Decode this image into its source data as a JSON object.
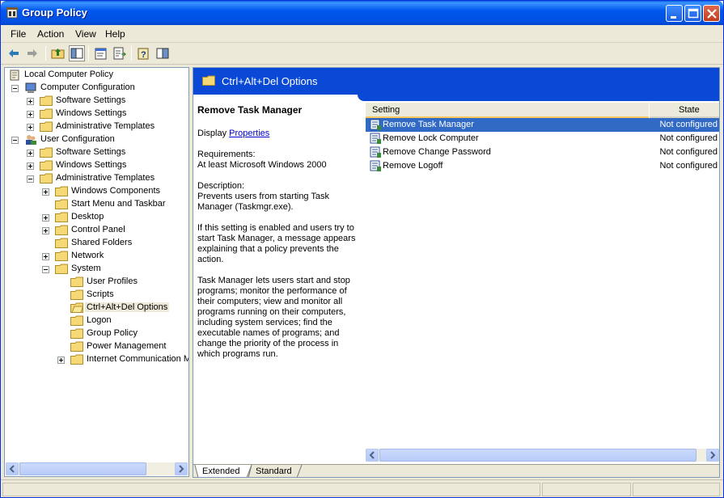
{
  "window": {
    "title": "Group Policy"
  },
  "menu": {
    "file": "File",
    "action": "Action",
    "view": "View",
    "help": "Help"
  },
  "tree": {
    "root": "Local Computer Policy",
    "computer_config": "Computer Configuration",
    "cc_software": "Software Settings",
    "cc_windows": "Windows Settings",
    "cc_admin": "Administrative Templates",
    "user_config": "User Configuration",
    "uc_software": "Software Settings",
    "uc_windows": "Windows Settings",
    "uc_admin": "Administrative Templates",
    "windows_components": "Windows Components",
    "start_menu": "Start Menu and Taskbar",
    "desktop": "Desktop",
    "control_panel": "Control Panel",
    "shared_folders": "Shared Folders",
    "network": "Network",
    "system": "System",
    "user_profiles": "User Profiles",
    "scripts": "Scripts",
    "ctrl_alt_del": "Ctrl+Alt+Del Options",
    "logon": "Logon",
    "group_policy": "Group Policy",
    "power_management": "Power Management",
    "internet_comm": "Internet Communication M"
  },
  "panel": {
    "header": "Ctrl+Alt+Del Options",
    "desc_title": "Remove Task Manager",
    "display_label": "Display",
    "properties_link": "Properties",
    "requirements_label": "Requirements:",
    "requirements_value": "At least Microsoft Windows 2000",
    "description_label": "Description:",
    "description_1": "Prevents users from starting Task Manager (Taskmgr.exe).",
    "description_2": "If this setting is enabled and users try to start Task Manager, a message appears explaining that a policy prevents the action.",
    "description_3": "Task Manager lets users start and stop programs; monitor the performance of their computers; view and monitor all programs running on their computers, including system services; find the executable names of programs; and change the priority of the process in which programs run."
  },
  "list": {
    "col_setting": "Setting",
    "col_state": "State",
    "rows": [
      {
        "name": "Remove Task Manager",
        "state": "Not configured"
      },
      {
        "name": "Remove Lock Computer",
        "state": "Not configured"
      },
      {
        "name": "Remove Change Password",
        "state": "Not configured"
      },
      {
        "name": "Remove Logoff",
        "state": "Not configured"
      }
    ]
  },
  "tabs": {
    "extended": "Extended",
    "standard": "Standard"
  },
  "colors": {
    "header_blue": "#0a48d6",
    "selection": "#316ac5",
    "title_blue": "#0058ee"
  }
}
